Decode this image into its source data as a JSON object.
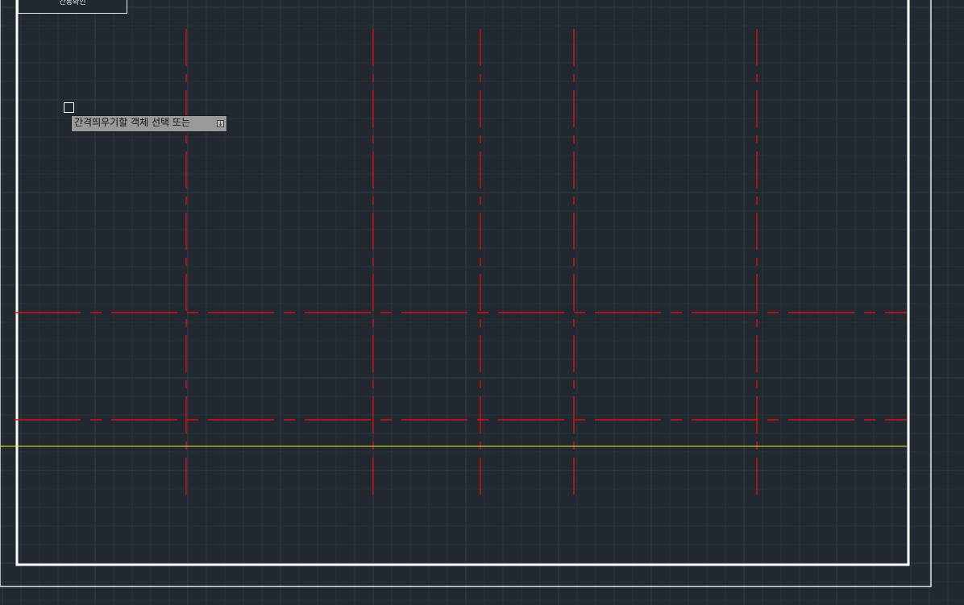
{
  "viewport": {
    "title_tab_label": "간통확인",
    "command_prompt": "간격띄우기할 객체 선택 또는",
    "prompt_options_icon": "down-arrow-icon"
  },
  "colors": {
    "background": "#212830",
    "grid_minor": "#2b333d",
    "grid_major": "#343d48",
    "border": "#ffffff",
    "gridline_red": "#e01010",
    "guide_yellow": "#e8e820"
  }
}
